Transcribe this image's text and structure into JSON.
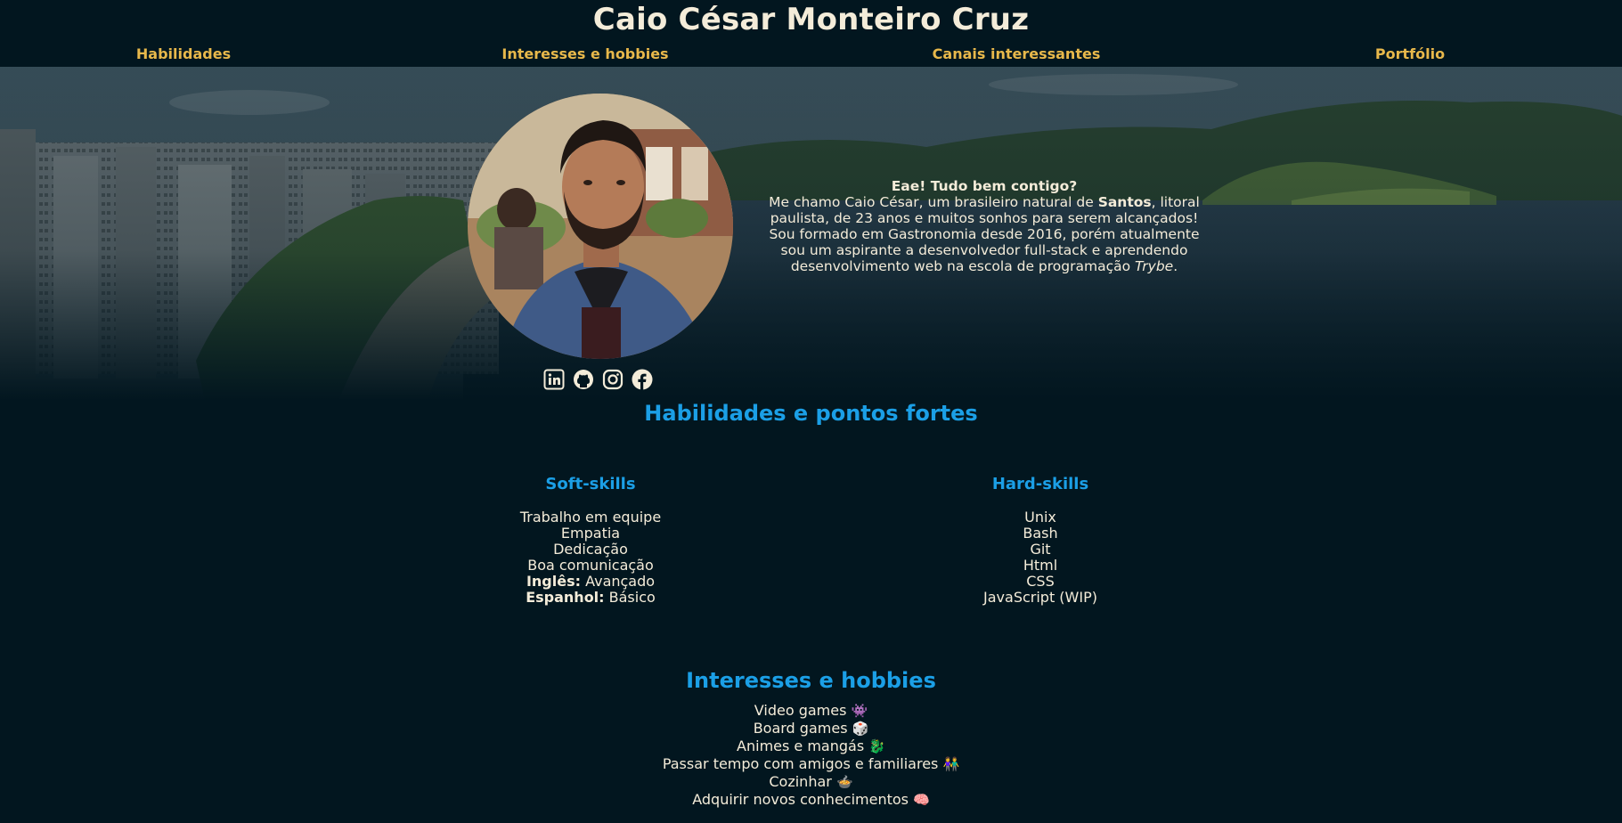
{
  "site_title": "Caio César Monteiro Cruz",
  "nav": [
    {
      "label": "Habilidades"
    },
    {
      "label": "Interesses e hobbies"
    },
    {
      "label": "Canais interessantes"
    },
    {
      "label": "Portfólio"
    }
  ],
  "intro": {
    "greeting": "Eae! Tudo bem contigo?",
    "line1_pre": "Me chamo Caio César, um brasileiro natural de ",
    "line1_city": "Santos",
    "line1_post": ", litoral paulista, de 23 anos e muitos sonhos para serem alcançados!",
    "line2_pre": "Sou formado em Gastronomia desde 2016, porém atualmente sou um aspirante a desenvolvedor full-stack e aprendendo desenvolvimento web na escola de programação ",
    "line2_school": "Trybe",
    "line2_post": "."
  },
  "socials": [
    {
      "icon": "linkedin-icon"
    },
    {
      "icon": "github-icon"
    },
    {
      "icon": "instagram-icon"
    },
    {
      "icon": "facebook-icon"
    }
  ],
  "skills": {
    "title": "Habilidades e pontos fortes",
    "soft": {
      "title": "Soft-skills",
      "items": [
        {
          "label": "",
          "text": "Trabalho em equipe"
        },
        {
          "label": "",
          "text": "Empatia"
        },
        {
          "label": "",
          "text": "Dedicação"
        },
        {
          "label": "",
          "text": "Boa comunicação"
        },
        {
          "label": "Inglês:",
          "text": " Avançado"
        },
        {
          "label": "Espanhol:",
          "text": " Básico"
        }
      ]
    },
    "hard": {
      "title": "Hard-skills",
      "items": [
        "Unix",
        "Bash",
        "Git",
        "Html",
        "CSS",
        "JavaScript (WIP)"
      ]
    }
  },
  "hobbies": {
    "title": "Interesses e hobbies",
    "items": [
      {
        "text": "Video games",
        "emoji": "👾"
      },
      {
        "text": "Board games",
        "emoji": "🎲"
      },
      {
        "text": "Animes e mangás",
        "emoji": "🐉"
      },
      {
        "text": "Passar tempo com amigos e familiares",
        "emoji": "👫"
      },
      {
        "text": "Cozinhar",
        "emoji": "🍲"
      },
      {
        "text": "Adquirir novos conhecimentos",
        "emoji": "🧠"
      }
    ]
  },
  "colors": {
    "background": "#02161f",
    "accent_blue": "#1b9fe6",
    "nav_gold": "#e8b84b",
    "text": "#f4ecd9"
  }
}
